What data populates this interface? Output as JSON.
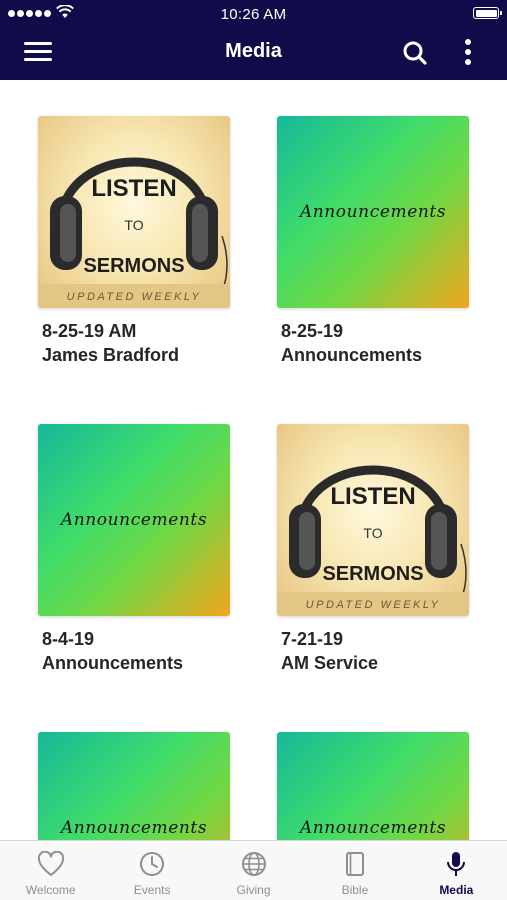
{
  "status_bar": {
    "time": "10:26 AM"
  },
  "header": {
    "title": "Media",
    "menu_icon": "hamburger-menu-icon",
    "search_icon": "search-icon",
    "more_icon": "more-vertical-icon"
  },
  "colors": {
    "header_bg": "#100c4a",
    "active_tab": "#100c4a",
    "inactive_tab": "#8e8e93"
  },
  "media_items": [
    {
      "thumbnail": "listen-to-sermons",
      "thumb_title": "LISTEN",
      "thumb_to": "TO",
      "thumb_sermons": "SERMONS",
      "thumb_footer": "UPDATED WEEKLY",
      "date": "8-25-19 AM",
      "name": "James Bradford"
    },
    {
      "thumbnail": "announcements",
      "thumb_text": "Announcements",
      "date": "8-25-19",
      "name": "Announcements"
    },
    {
      "thumbnail": "announcements",
      "thumb_text": "Announcements",
      "date": "8-4-19",
      "name": "Announcements"
    },
    {
      "thumbnail": "listen-to-sermons",
      "thumb_title": "LISTEN",
      "thumb_to": "TO",
      "thumb_sermons": "SERMONS",
      "thumb_footer": "UPDATED WEEKLY",
      "date": "7-21-19",
      "name": "AM Service"
    },
    {
      "thumbnail": "announcements",
      "thumb_text": "Announcements",
      "date": "",
      "name": ""
    },
    {
      "thumbnail": "announcements",
      "thumb_text": "Announcements",
      "date": "",
      "name": ""
    }
  ],
  "tabs": [
    {
      "label": "Welcome",
      "icon": "heart-icon",
      "active": false
    },
    {
      "label": "Events",
      "icon": "clock-icon",
      "active": false
    },
    {
      "label": "Giving",
      "icon": "globe-icon",
      "active": false
    },
    {
      "label": "Bible",
      "icon": "book-icon",
      "active": false
    },
    {
      "label": "Media",
      "icon": "microphone-icon",
      "active": true
    }
  ]
}
